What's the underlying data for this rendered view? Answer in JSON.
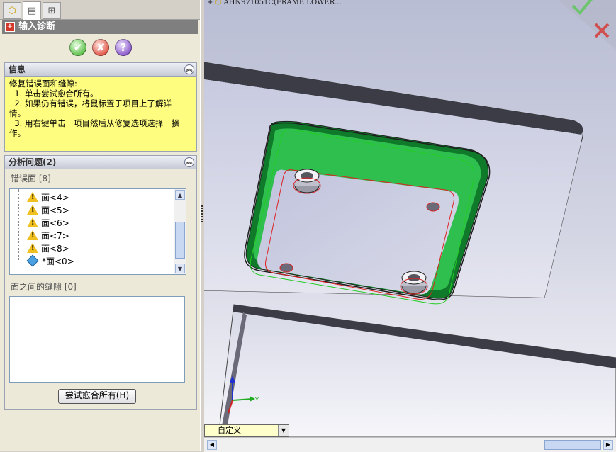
{
  "tabs": [
    {
      "name": "feature-manager",
      "icon": "feature-tree-icon"
    },
    {
      "name": "property-manager",
      "icon": "property-icon"
    },
    {
      "name": "configuration-manager",
      "icon": "config-icon"
    }
  ],
  "property_manager": {
    "title": "输入诊断",
    "ok_symbol": "✔",
    "cancel_symbol": "✘",
    "help_symbol": "?"
  },
  "info": {
    "header": "信息",
    "lines": [
      "修复错误面和缝隙:",
      "  1. 单击尝试愈合所有。",
      "  2. 如果仍有错误，将鼠标置于项目上了解详\n情。",
      "  3. 用右键单击一项目然后从修复选项选择一操\n作。"
    ]
  },
  "analysis": {
    "header": "分析问题(2)",
    "faces_label": "错误面 [8]",
    "faces": [
      {
        "label": "面<4>",
        "kind": "warning"
      },
      {
        "label": "面<5>",
        "kind": "warning"
      },
      {
        "label": "面<6>",
        "kind": "warning"
      },
      {
        "label": "面<7>",
        "kind": "warning"
      },
      {
        "label": "面<8>",
        "kind": "warning"
      },
      {
        "label": "*面<0>",
        "kind": "face"
      }
    ],
    "gaps_label": "面之间的缝隙 [0]",
    "try_heal_button": "尝试愈合所有(H)"
  },
  "graphics": {
    "tree_caption": "AHN971051C(FRAME LOWER...",
    "view_orientation": "自定义"
  }
}
